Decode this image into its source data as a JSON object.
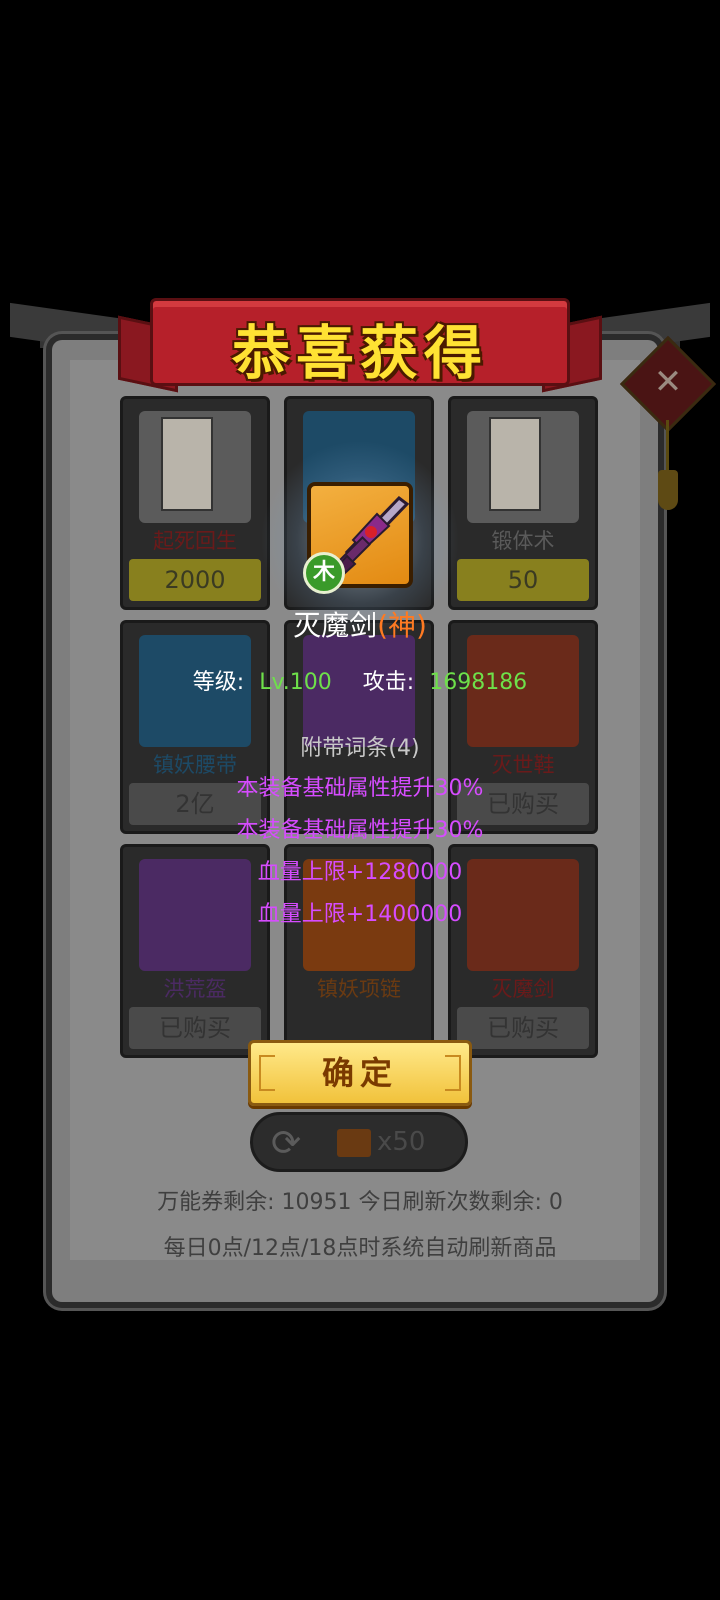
{
  "banner": {
    "title": "恭喜获得"
  },
  "reward": {
    "item_name": "灭魔剑",
    "quality": "(神)",
    "element": "木",
    "level_label": "等级:",
    "level_value": "Lv.100",
    "attack_label": "攻击:",
    "attack_value": "1698186",
    "affix_title": "附带词条(4)",
    "affixes": [
      "本装备基础属性提升30%",
      "本装备基础属性提升30%",
      "血量上限+1280000",
      "血量上限+1400000"
    ],
    "confirm_label": "确定"
  },
  "shop": {
    "items": [
      {
        "name": "起死回生",
        "price": "2000"
      },
      {
        "name": "",
        "price": ""
      },
      {
        "name": "锻体术",
        "price": "50"
      },
      {
        "name": "镇妖腰带",
        "price": "2亿"
      },
      {
        "name": "",
        "price": ""
      },
      {
        "name": "灭世鞋",
        "price": "已购买"
      },
      {
        "name": "洪荒盔",
        "price": "已购买"
      },
      {
        "name": "镇妖项链",
        "price": ""
      },
      {
        "name": "灭魔剑",
        "price": "已购买"
      }
    ],
    "refresh_cost": "x50",
    "status_line": "万能券剩余: 10951  今日刷新次数剩余: 0",
    "refresh_note": "每日0点/12点/18点时系统自动刷新商品"
  },
  "colors": {
    "quality_god": "#ff7a22",
    "stat_value": "#6ee04a",
    "affix": "#d64cff"
  }
}
